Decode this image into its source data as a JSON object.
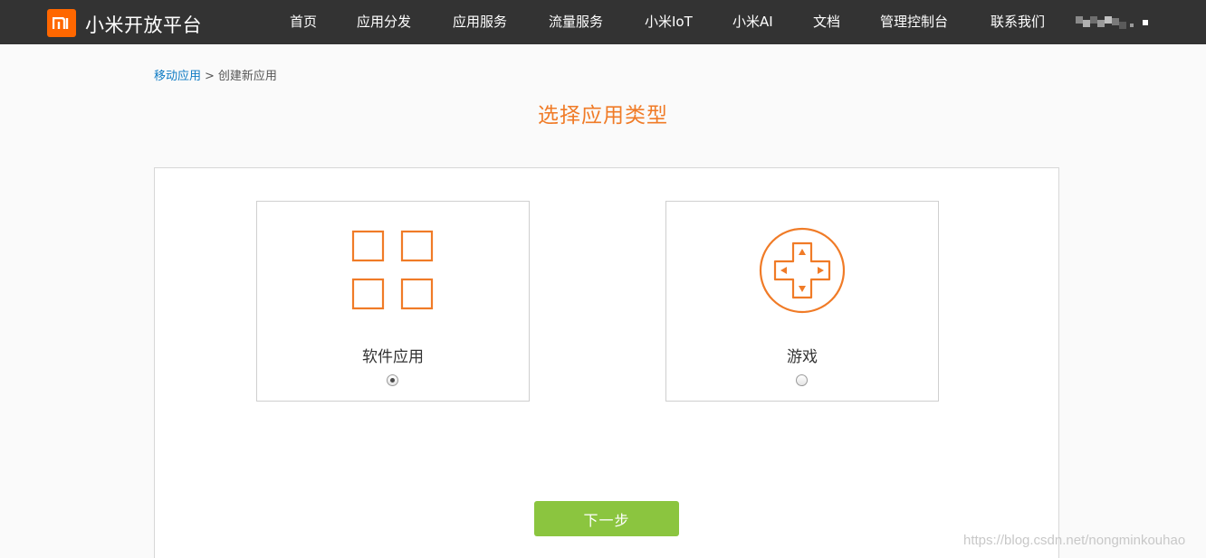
{
  "header": {
    "brand": "小米开放平台",
    "logo_text": "mi",
    "nav": [
      {
        "label": "首页"
      },
      {
        "label": "应用分发"
      },
      {
        "label": "应用服务"
      },
      {
        "label": "流量服务"
      },
      {
        "label": "小米IoT"
      },
      {
        "label": "小米AI"
      },
      {
        "label": "文档"
      },
      {
        "label": "管理控制台"
      },
      {
        "label": "联系我们"
      }
    ]
  },
  "breadcrumb": {
    "parent": "移动应用",
    "separator": ">",
    "current": "创建新应用"
  },
  "page_title": "选择应用类型",
  "options": [
    {
      "label": "软件应用",
      "icon": "app-grid-icon",
      "selected": true
    },
    {
      "label": "游戏",
      "icon": "gamepad-icon",
      "selected": false
    }
  ],
  "next_button": "下一步",
  "watermark": "https://blog.csdn.net/nongminkouhao",
  "colors": {
    "header_bg": "#333333",
    "brand_orange": "#ff6700",
    "title_orange": "#f07b27",
    "link_blue": "#0e7bc4",
    "button_green": "#8bc53f"
  }
}
